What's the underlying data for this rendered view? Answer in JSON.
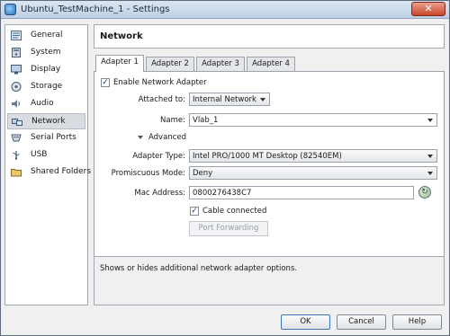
{
  "window": {
    "title": "Ubuntu_TestMachine_1 - Settings",
    "close_glyph": "✕"
  },
  "sidebar": {
    "items": [
      {
        "label": "General",
        "icon": "general-icon"
      },
      {
        "label": "System",
        "icon": "system-icon"
      },
      {
        "label": "Display",
        "icon": "display-icon"
      },
      {
        "label": "Storage",
        "icon": "storage-icon"
      },
      {
        "label": "Audio",
        "icon": "audio-icon"
      },
      {
        "label": "Network",
        "icon": "network-icon",
        "selected": true
      },
      {
        "label": "Serial Ports",
        "icon": "serial-ports-icon"
      },
      {
        "label": "USB",
        "icon": "usb-icon"
      },
      {
        "label": "Shared Folders",
        "icon": "shared-folders-icon"
      }
    ]
  },
  "section": {
    "title": "Network"
  },
  "tabs": [
    {
      "label": "Adapter 1",
      "active": true
    },
    {
      "label": "Adapter 2"
    },
    {
      "label": "Adapter 3"
    },
    {
      "label": "Adapter 4"
    }
  ],
  "form": {
    "enable_adapter": {
      "label": "Enable Network Adapter",
      "checked": true
    },
    "attached_to": {
      "label": "Attached to:",
      "value": "Internal Network"
    },
    "name": {
      "label": "Name:",
      "value": "Vlab_1"
    },
    "advanced": {
      "label": "Advanced",
      "expanded": true
    },
    "adapter_type": {
      "label": "Adapter Type:",
      "value": "Intel PRO/1000 MT Desktop (82540EM)"
    },
    "promiscuous_mode": {
      "label": "Promiscuous Mode:",
      "value": "Deny"
    },
    "mac_address": {
      "label": "Mac Address:",
      "value": "0800276438C7"
    },
    "cable_connected": {
      "label": "Cable connected",
      "checked": true
    },
    "port_forwarding": {
      "label": "Port Forwarding",
      "enabled": false
    },
    "check_glyph": "✓",
    "refresh_glyph": "↻"
  },
  "description": "Shows or hides additional network adapter options.",
  "buttons": {
    "ok": "OK",
    "cancel": "Cancel",
    "help": "Help"
  },
  "colors": {
    "titlebar": "#c9d8ea",
    "selected_item": "#d9dde2",
    "panel_bg": "#ffffff",
    "window_bg": "#f0f0f0"
  }
}
